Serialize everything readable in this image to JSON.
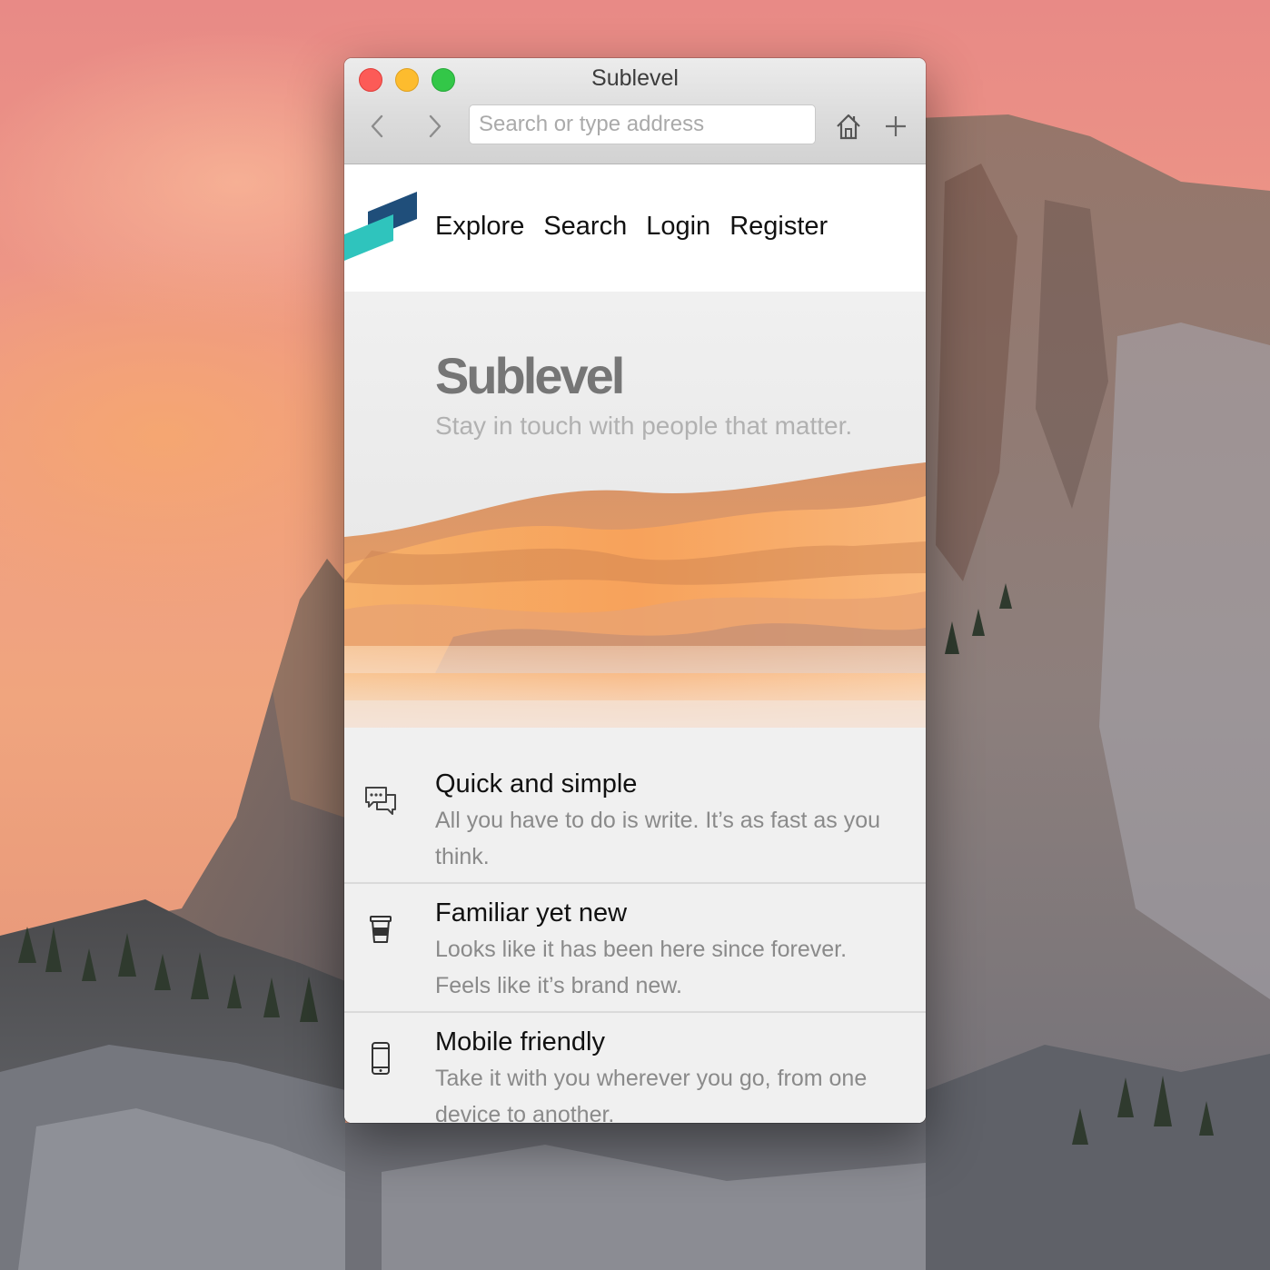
{
  "window": {
    "title": "Sublevel"
  },
  "toolbar": {
    "address_placeholder": "Search or type address",
    "address_value": "",
    "icons": [
      "chevron-left-icon",
      "chevron-right-icon",
      "home-icon",
      "plus-icon"
    ]
  },
  "site": {
    "nav": [
      {
        "label": "Explore"
      },
      {
        "label": "Search"
      },
      {
        "label": "Login"
      },
      {
        "label": "Register"
      }
    ],
    "logo_colors": [
      "#1f4e7a",
      "#2fc4bd"
    ]
  },
  "hero": {
    "title": "Sublevel",
    "subtitle": "Stay in touch with people that matter."
  },
  "features": [
    {
      "icon": "chat-bubbles-icon",
      "title": "Quick and simple",
      "description": "All you have to do is write. It’s as fast as you think."
    },
    {
      "icon": "coffee-cup-icon",
      "title": "Familiar yet new",
      "description": "Looks like it has been here since forever. Feels like it’s brand new."
    },
    {
      "icon": "smartphone-icon",
      "title": "Mobile friendly",
      "description": "Take it with you wherever you go, from one device to another."
    }
  ]
}
